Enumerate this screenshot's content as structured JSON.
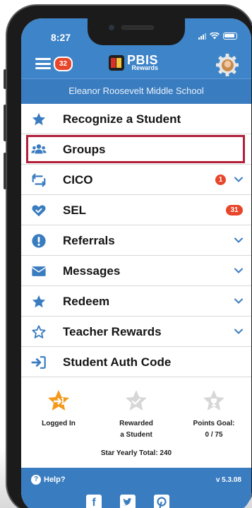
{
  "status_bar": {
    "time": "8:27"
  },
  "header": {
    "notification_count": "32",
    "logo_title": "PBIS",
    "logo_subtitle": "Rewards",
    "school_name": "Eleanor Roosevelt Middle School"
  },
  "menu": {
    "items": [
      {
        "label": "Recognize a Student",
        "icon": "star-icon"
      },
      {
        "label": "Groups",
        "icon": "users-icon",
        "highlighted": true
      },
      {
        "label": "CICO",
        "icon": "swap-arrows-icon",
        "badge": "1",
        "expandable": true
      },
      {
        "label": "SEL",
        "icon": "heart-check-icon",
        "badge": "31"
      },
      {
        "label": "Referrals",
        "icon": "exclamation-icon",
        "expandable": true
      },
      {
        "label": "Messages",
        "icon": "envelope-icon",
        "expandable": true
      },
      {
        "label": "Redeem",
        "icon": "star-icon",
        "expandable": true
      },
      {
        "label": "Teacher Rewards",
        "icon": "star-outline-icon",
        "expandable": true
      },
      {
        "label": "Student Auth Code",
        "icon": "sign-in-icon"
      }
    ]
  },
  "stats": {
    "logged_in_label": "Logged In",
    "rewarded_label_1": "Rewarded",
    "rewarded_label_2": "a Student",
    "points_goal_label": "Points Goal:",
    "points_goal_value": "0 / 75",
    "yearly_total": "Star Yearly Total: 240"
  },
  "footer": {
    "help_label": "Help?",
    "version": "v 5.3.08",
    "social": [
      "facebook-icon",
      "twitter-icon",
      "pinterest-icon"
    ]
  },
  "colors": {
    "header_blue": "#3e84c8",
    "school_bar_blue": "#3a7cc0",
    "badge_red": "#e8462a",
    "highlight_red": "#b31f3b",
    "icon_blue": "#3a7cc0",
    "star_orange": "#f39a1e"
  }
}
